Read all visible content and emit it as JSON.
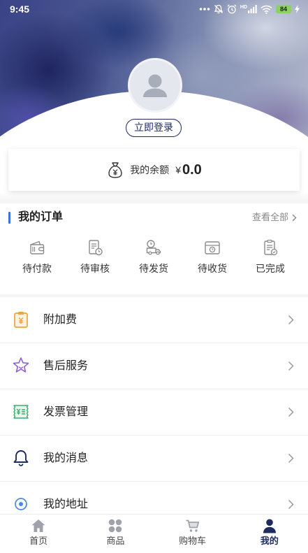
{
  "status_bar": {
    "time": "9:45",
    "network_badge": "HD",
    "battery": "84",
    "icons": [
      "more-dots-icon",
      "mute-icon",
      "alarm-icon",
      "signal-icon",
      "wifi-icon",
      "battery-icon",
      "charging-icon"
    ]
  },
  "profile": {
    "avatar_icon": "user-avatar-icon",
    "login_label": "立即登录"
  },
  "balance": {
    "icon": "money-bag-icon",
    "label": "我的余额",
    "currency": "¥",
    "amount": "0.0"
  },
  "orders": {
    "title": "我的订单",
    "view_all": "查看全部",
    "items": [
      {
        "label": "待付款",
        "icon": "wallet-icon"
      },
      {
        "label": "待审核",
        "icon": "document-clock-icon"
      },
      {
        "label": "待发货",
        "icon": "delivery-truck-icon"
      },
      {
        "label": "待收货",
        "icon": "package-clock-icon"
      },
      {
        "label": "已完成",
        "icon": "clipboard-check-icon"
      }
    ]
  },
  "menu": [
    {
      "label": "附加费",
      "icon": "surcharge-clipboard-icon",
      "color": "#F0A33A"
    },
    {
      "label": "售后服务",
      "icon": "star-icon",
      "color": "#8C5FD6"
    },
    {
      "label": "发票管理",
      "icon": "invoice-icon",
      "color": "#3BAF6E"
    },
    {
      "label": "我的消息",
      "icon": "bell-icon",
      "color": "#1E2B5E"
    },
    {
      "label": "我的地址",
      "icon": "location-icon",
      "color": "#4A8BDB"
    }
  ],
  "tabs": [
    {
      "label": "首页",
      "icon": "home-icon",
      "active": false
    },
    {
      "label": "商品",
      "icon": "grid-icon",
      "active": false
    },
    {
      "label": "购物车",
      "icon": "cart-icon",
      "active": false
    },
    {
      "label": "我的",
      "icon": "profile-icon",
      "active": true
    }
  ],
  "colors": {
    "accent": "#1E2B5E",
    "section_marker": "#3B74D4",
    "battery": "#8BD35F"
  }
}
